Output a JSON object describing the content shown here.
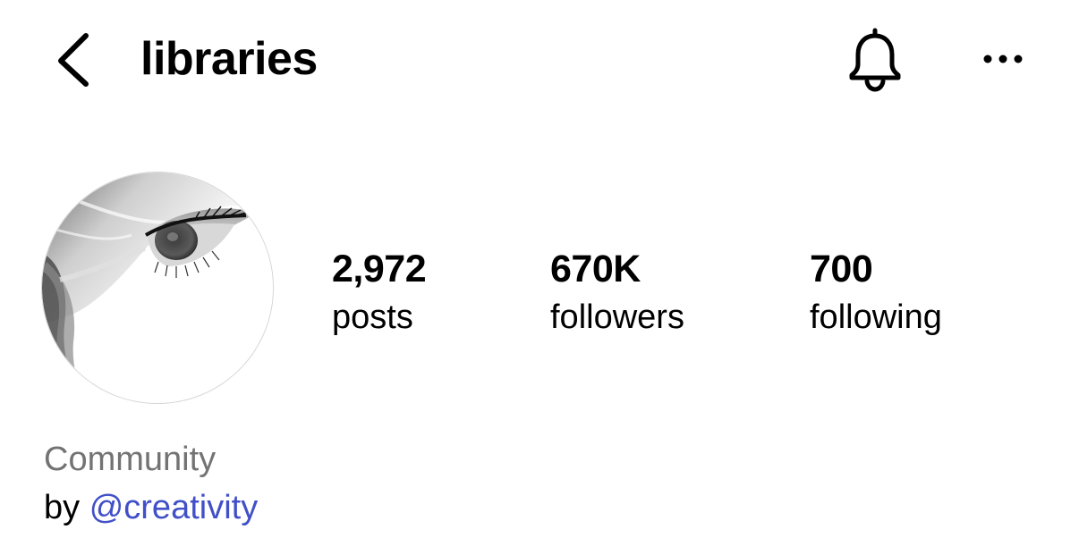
{
  "header": {
    "title": "libraries",
    "back_icon": "chevron-left-icon",
    "notification_icon": "bell-icon",
    "more_icon": "ellipsis-icon"
  },
  "profile": {
    "avatar_icon": "eye-artwork",
    "stats": [
      {
        "value": "2,972",
        "label": "posts"
      },
      {
        "value": "670K",
        "label": "followers"
      },
      {
        "value": "700",
        "label": "following"
      }
    ],
    "category": "Community",
    "byline_prefix": "by",
    "byline_handle": "@creativity"
  },
  "colors": {
    "text": "#000000",
    "category": "#737373",
    "link": "#4150c8"
  }
}
